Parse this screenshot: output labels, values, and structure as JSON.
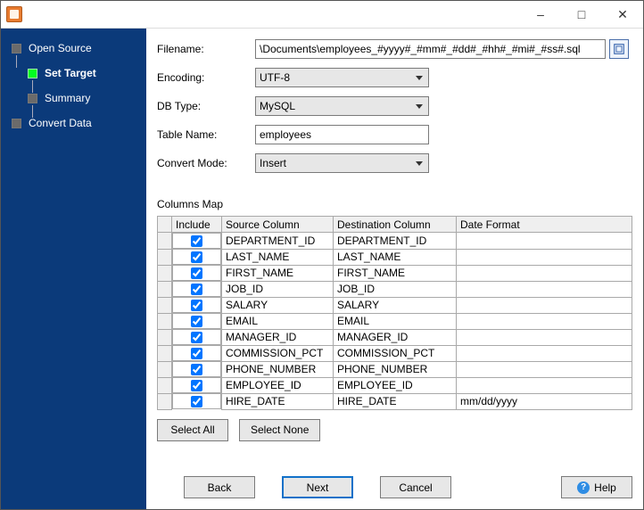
{
  "sidebar": {
    "items": [
      {
        "label": "Open Source",
        "active": false,
        "sub": false
      },
      {
        "label": "Set Target",
        "active": true,
        "sub": true
      },
      {
        "label": "Summary",
        "active": false,
        "sub": true
      },
      {
        "label": "Convert Data",
        "active": false,
        "sub": false
      }
    ]
  },
  "form": {
    "filename_label": "Filename:",
    "filename_value": "\\Documents\\employees_#yyyy#_#mm#_#dd#_#hh#_#mi#_#ss#.sql",
    "encoding_label": "Encoding:",
    "encoding_value": "UTF-8",
    "dbtype_label": "DB Type:",
    "dbtype_value": "MySQL",
    "tablename_label": "Table Name:",
    "tablename_value": "employees",
    "convertmode_label": "Convert Mode:",
    "convertmode_value": "Insert"
  },
  "columns_map": {
    "title": "Columns Map",
    "headers": {
      "include": "Include",
      "source": "Source Column",
      "dest": "Destination Column",
      "datefmt": "Date Format"
    },
    "rows": [
      {
        "include": true,
        "source": "DEPARTMENT_ID",
        "dest": "DEPARTMENT_ID",
        "datefmt": ""
      },
      {
        "include": true,
        "source": "LAST_NAME",
        "dest": "LAST_NAME",
        "datefmt": ""
      },
      {
        "include": true,
        "source": "FIRST_NAME",
        "dest": "FIRST_NAME",
        "datefmt": ""
      },
      {
        "include": true,
        "source": "JOB_ID",
        "dest": "JOB_ID",
        "datefmt": ""
      },
      {
        "include": true,
        "source": "SALARY",
        "dest": "SALARY",
        "datefmt": ""
      },
      {
        "include": true,
        "source": "EMAIL",
        "dest": "EMAIL",
        "datefmt": ""
      },
      {
        "include": true,
        "source": "MANAGER_ID",
        "dest": "MANAGER_ID",
        "datefmt": ""
      },
      {
        "include": true,
        "source": "COMMISSION_PCT",
        "dest": "COMMISSION_PCT",
        "datefmt": ""
      },
      {
        "include": true,
        "source": "PHONE_NUMBER",
        "dest": "PHONE_NUMBER",
        "datefmt": ""
      },
      {
        "include": true,
        "source": "EMPLOYEE_ID",
        "dest": "EMPLOYEE_ID",
        "datefmt": ""
      },
      {
        "include": true,
        "source": "HIRE_DATE",
        "dest": "HIRE_DATE",
        "datefmt": "mm/dd/yyyy"
      }
    ]
  },
  "buttons": {
    "select_all": "Select All",
    "select_none": "Select None",
    "back": "Back",
    "next": "Next",
    "cancel": "Cancel",
    "help": "Help"
  }
}
